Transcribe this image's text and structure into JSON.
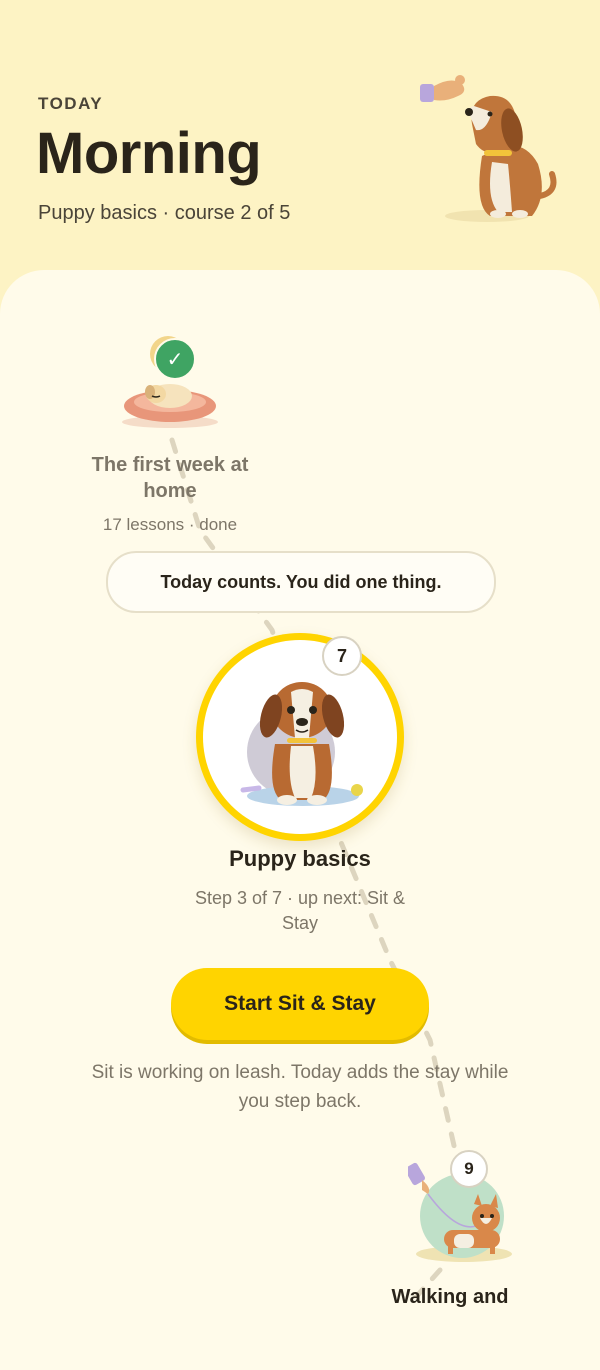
{
  "header": {
    "eyebrow": "TODAY",
    "title": "Morning",
    "subtitle": "Puppy basics · course 2 of 5"
  },
  "path": {
    "completed": {
      "title": "The first week at home",
      "meta": "17 lessons · done",
      "status_icon": "check-icon"
    },
    "toast": "Today counts. You did one thing.",
    "current": {
      "step_count": "7",
      "title": "Puppy basics",
      "meta": "Step 3 of 7 · up next: Sit & Stay",
      "cta": "Start Sit & Stay",
      "note": "Sit is working on leash. Today adds the stay while you step back."
    },
    "next": {
      "step_count": "9",
      "title": "Walking and"
    }
  },
  "colors": {
    "accent": "#ffd400",
    "success": "#3fa463",
    "background": "#fdf3c4",
    "panel": "#fffbea"
  }
}
